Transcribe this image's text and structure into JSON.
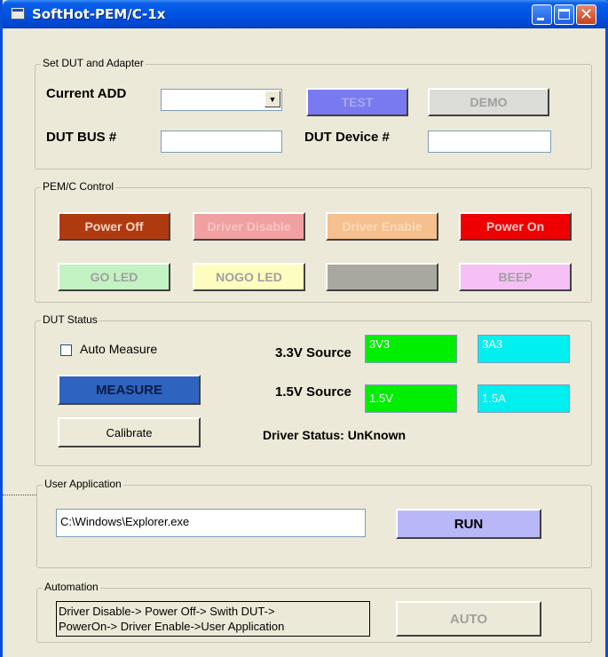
{
  "window": {
    "title": "SoftHot-PEM/C-1x"
  },
  "set_dut": {
    "legend": "Set DUT and Adapter",
    "current_add_label": "Current ADD",
    "current_add_value": "",
    "test_label": "TEST",
    "demo_label": "DEMO",
    "dut_bus_label": "DUT BUS #",
    "dut_bus_value": "",
    "dut_device_label": "DUT Device #",
    "dut_device_value": ""
  },
  "pem_control": {
    "legend": "PEM/C Control",
    "power_off_label": "Power Off",
    "driver_disable_label": "Driver Disable",
    "driver_enable_label": "Driver Enable",
    "power_on_label": "Power On",
    "go_led_label": "GO LED",
    "nogo_led_label": "NOGO LED",
    "blank_label": "",
    "beep_label": "BEEP"
  },
  "dut_status": {
    "legend": "DUT Status",
    "auto_measure_label": "Auto Measure",
    "auto_measure_checked": false,
    "measure_label": "MEASURE",
    "calibrate_label": "Calibrate",
    "src33_label": "3.3V Source",
    "src33_voltage": "3V3",
    "src33_current": "3A3",
    "src15_label": "1.5V Source",
    "src15_voltage": "1.5V",
    "src15_current": "1.5A",
    "driver_status": "Driver Status: UnKnown"
  },
  "user_app": {
    "legend": "User Application",
    "path_value": "C:\\Windows\\Explorer.exe",
    "run_label": "RUN"
  },
  "automation": {
    "legend": "Automation",
    "sequence_line1": "Driver Disable-> Power Off-> Swith DUT->",
    "sequence_line2": "PowerOn-> Driver Enable->User Application",
    "auto_label": "AUTO"
  },
  "colors": {
    "title_bar": "#0054e3",
    "dialog_bg": "#ece9d8",
    "test_button": "#7a7af0",
    "power_off": "#b03a10",
    "driver_disable": "#f0a0a0",
    "driver_enable": "#f5c08e",
    "power_on": "#ee0000",
    "go_led": "#c3f2c3",
    "nogo_led": "#fdfdc0",
    "blank_button": "#a8a8a0",
    "beep": "#f6c0f6",
    "measure": "#2f63c0",
    "voltage_box": "#00ee00",
    "current_box": "#00f0f0",
    "run_button": "#b8b8f8"
  }
}
